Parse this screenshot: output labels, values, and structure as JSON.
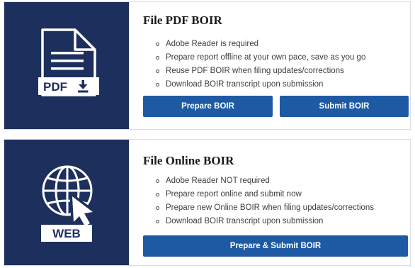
{
  "pdf_card": {
    "icon_label": "PDF",
    "title": "File PDF BOIR",
    "bullets": [
      "Adobe Reader is required",
      "Prepare report offline at your own pace, save as you go",
      "Reuse PDF BOIR when filing updates/corrections",
      "Download BOIR transcript upon submission"
    ],
    "prepare_button": "Prepare BOIR",
    "submit_button": "Submit BOIR"
  },
  "web_card": {
    "icon_label": "WEB",
    "title": "File Online BOIR",
    "bullets": [
      "Adobe Reader NOT required",
      "Prepare report online and submit now",
      "Prepare new Online BOIR when filing updates/corrections",
      "Download BOIR transcript upon submission"
    ],
    "prepare_submit_button": "Prepare & Submit BOIR"
  },
  "colors": {
    "panel": "#1d2f5c",
    "button": "#1d5aa3",
    "title": "#1a1a1a"
  },
  "icons": [
    "pdf-document-icon",
    "download-icon",
    "globe-icon",
    "cursor-arrow-icon"
  ]
}
